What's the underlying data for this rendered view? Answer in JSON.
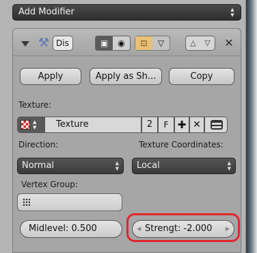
{
  "add_modifier": {
    "label": "Add Modifier"
  },
  "modifier": {
    "name_short": "Dis",
    "apply_label": "Apply",
    "apply_shape_label": "Apply as Sh...",
    "copy_label": "Copy"
  },
  "texture": {
    "label": "Texture:",
    "name": "Texture",
    "users": "2",
    "fake_user": "F"
  },
  "direction": {
    "label": "Direction:",
    "value": "Normal"
  },
  "texture_coordinates": {
    "label": "Texture Coordinates:",
    "value": "Local"
  },
  "vertex_group": {
    "label": "Vertex Group:",
    "value": ""
  },
  "midlevel": {
    "label": "Midlevel:",
    "value": "0.500"
  },
  "strength": {
    "label": "Strengt:",
    "value": "-2.000"
  },
  "colors": {
    "highlight": "#e0262c",
    "panel_bg": "#a6a6a6",
    "dropdown_bg": "#3b3b3b"
  },
  "icons": [
    "collapse-triangle-icon",
    "wrench-icon",
    "camera-icon",
    "eye-icon",
    "editmode-icon",
    "cage-icon",
    "move-up-icon",
    "move-down-icon",
    "close-icon",
    "checker-texture-icon",
    "new-texture-icon",
    "unlink-icon",
    "browse-icon",
    "vertex-group-icon"
  ]
}
